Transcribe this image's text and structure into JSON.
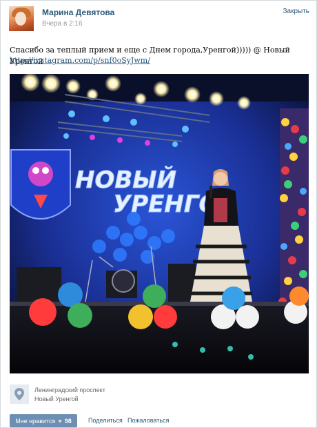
{
  "post": {
    "author": "Марина Девятова",
    "time": "Вчера в 2:16",
    "close_label": "Закрыть",
    "text": "Спасибо за теплый прием и еще с Днем города,Уренгой))))) @ Новый Уренгой",
    "link": "http://instagram.com/p/snf0oSyJwm/",
    "photo_sign_line1": "НОВЫЙ",
    "photo_sign_line2": "УРЕНГО"
  },
  "location": {
    "street": "Ленинградский проспект",
    "city": "Новый Уренгой",
    "icon": "map-pin-icon"
  },
  "actions": {
    "like_label": "Мне нравится",
    "like_count": "98",
    "share_label": "Поделиться",
    "report_label": "Пожаловаться"
  },
  "colors": {
    "link": "#2b587a",
    "like_button": "#6d8fb3",
    "stage_blue": "#1d3fb5"
  }
}
